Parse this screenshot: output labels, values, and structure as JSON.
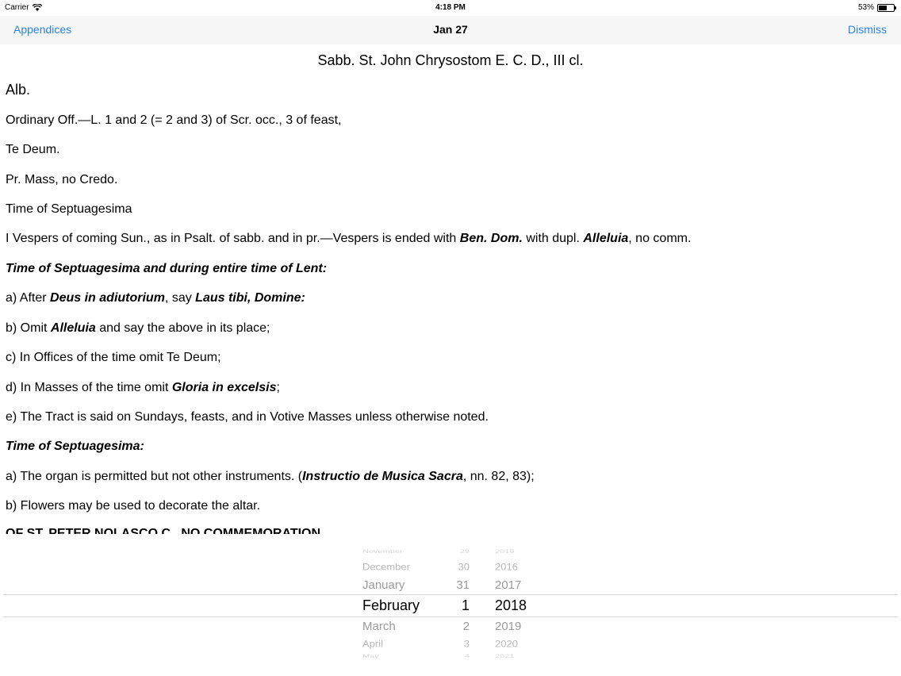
{
  "status_bar": {
    "carrier": "Carrier",
    "wifi_icon": "wifi-icon",
    "time": "4:18 PM",
    "battery_percent": "53%",
    "battery_level": 0.53
  },
  "nav": {
    "left_label": "Appendices",
    "title": "Jan 27",
    "right_label": "Dismiss",
    "accent_color": "#2a82e4"
  },
  "document": {
    "title": "Sabb. St. John Chrysostom E. C. D., III cl.",
    "color_line": "Alb.",
    "line1": "Ordinary Off.—L. 1 and 2 (= 2 and 3) of Scr. occ., 3 of feast,",
    "line2": "Te Deum.",
    "line3": "Pr. Mass, no Credo.",
    "line4": "Time of Septuagesima",
    "line5": {
      "p1": "I Vespers of coming Sun., as in Psalt. of sabb. and in pr.—Vespers is ended with ",
      "b1": "Ben. Dom.",
      "p2": " with dupl. ",
      "b2": "Alleluia",
      "p3": ", no comm."
    },
    "heading1": "Time of Septuagesima and during entire time of Lent:",
    "item_a": {
      "p1": "a) After ",
      "b1": "Deus in adiutorium",
      "p2": ", say ",
      "b2": "Laus tibi, Domine:"
    },
    "item_b": {
      "p1": "b) Omit ",
      "b1": "Alleluia",
      "p2": " and say the above in its place;"
    },
    "item_c": "c) In Offices of the time omit Te Deum;",
    "item_d": {
      "p1": "d) In Masses of the time omit ",
      "b1": "Gloria in excelsis",
      "p2": ";"
    },
    "item_e": "e) The Tract is said on Sundays, feasts, and in Votive Masses unless otherwise noted.",
    "heading2": "Time of Septuagesima:",
    "item_a2": {
      "p1": "a) The organ is permitted but not other instruments. (",
      "b1": "Instructio de Musica Sacra",
      "p2": ", nn. 82, 83);"
    },
    "item_b2": "b) Flowers may be used to decorate the altar.",
    "cut_line": "OF ST. PETER NOLASCO C., NO COMMEMORATION"
  },
  "picker": {
    "months": [
      "November",
      "December",
      "January",
      "February",
      "March",
      "April",
      "May"
    ],
    "days": [
      "29",
      "30",
      "31",
      "1",
      "2",
      "3",
      "4"
    ],
    "years": [
      "2015",
      "2016",
      "2017",
      "2018",
      "2019",
      "2020",
      "2021"
    ],
    "selected": {
      "month": "February",
      "day": "1",
      "year": "2018"
    }
  }
}
